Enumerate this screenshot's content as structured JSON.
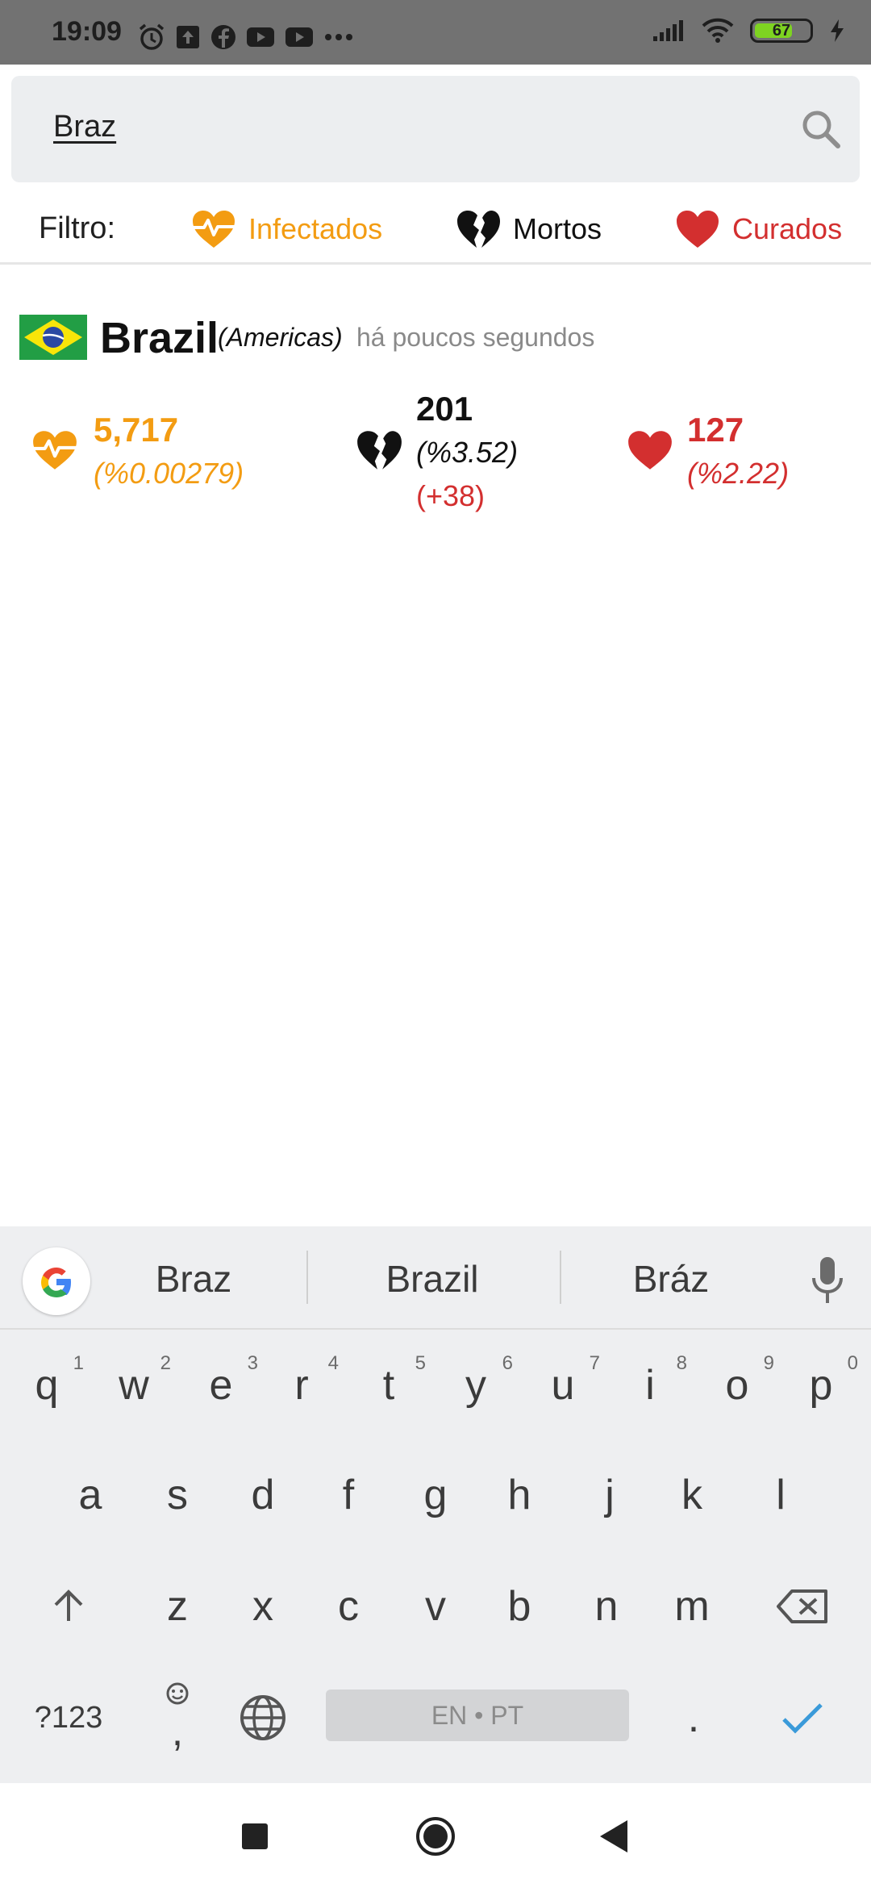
{
  "status_bar": {
    "time": "19:09",
    "battery": "67"
  },
  "search": {
    "value": "Braz"
  },
  "filter": {
    "label": "Filtro:",
    "items": [
      {
        "label": "Infectados",
        "color": "#f39c12"
      },
      {
        "label": "Mortos",
        "color": "#111111"
      },
      {
        "label": "Curados",
        "color": "#d32f2f"
      }
    ]
  },
  "country": {
    "name": "Brazil",
    "region": "(Americas)",
    "updated": "há poucos segundos",
    "infected": {
      "count": "5,717",
      "pct": "(%0.00279)"
    },
    "deaths": {
      "count": "201",
      "pct": "(%3.52)",
      "delta": "(+38)"
    },
    "recovered": {
      "count": "127",
      "pct": "(%2.22)"
    }
  },
  "keyboard": {
    "suggestions": [
      "Braz",
      "Brazil",
      "Bráz"
    ],
    "row1": [
      "q",
      "w",
      "e",
      "r",
      "t",
      "y",
      "u",
      "i",
      "o",
      "p"
    ],
    "row1_hints": [
      "1",
      "2",
      "3",
      "4",
      "5",
      "6",
      "7",
      "8",
      "9",
      "0"
    ],
    "row2": [
      "a",
      "s",
      "d",
      "f",
      "g",
      "h",
      "j",
      "k",
      "l"
    ],
    "row3": [
      "z",
      "x",
      "c",
      "v",
      "b",
      "n",
      "m"
    ],
    "symbols_label": "?123",
    "emoji_comma": ",",
    "space_label": "EN • PT",
    "period": "."
  }
}
